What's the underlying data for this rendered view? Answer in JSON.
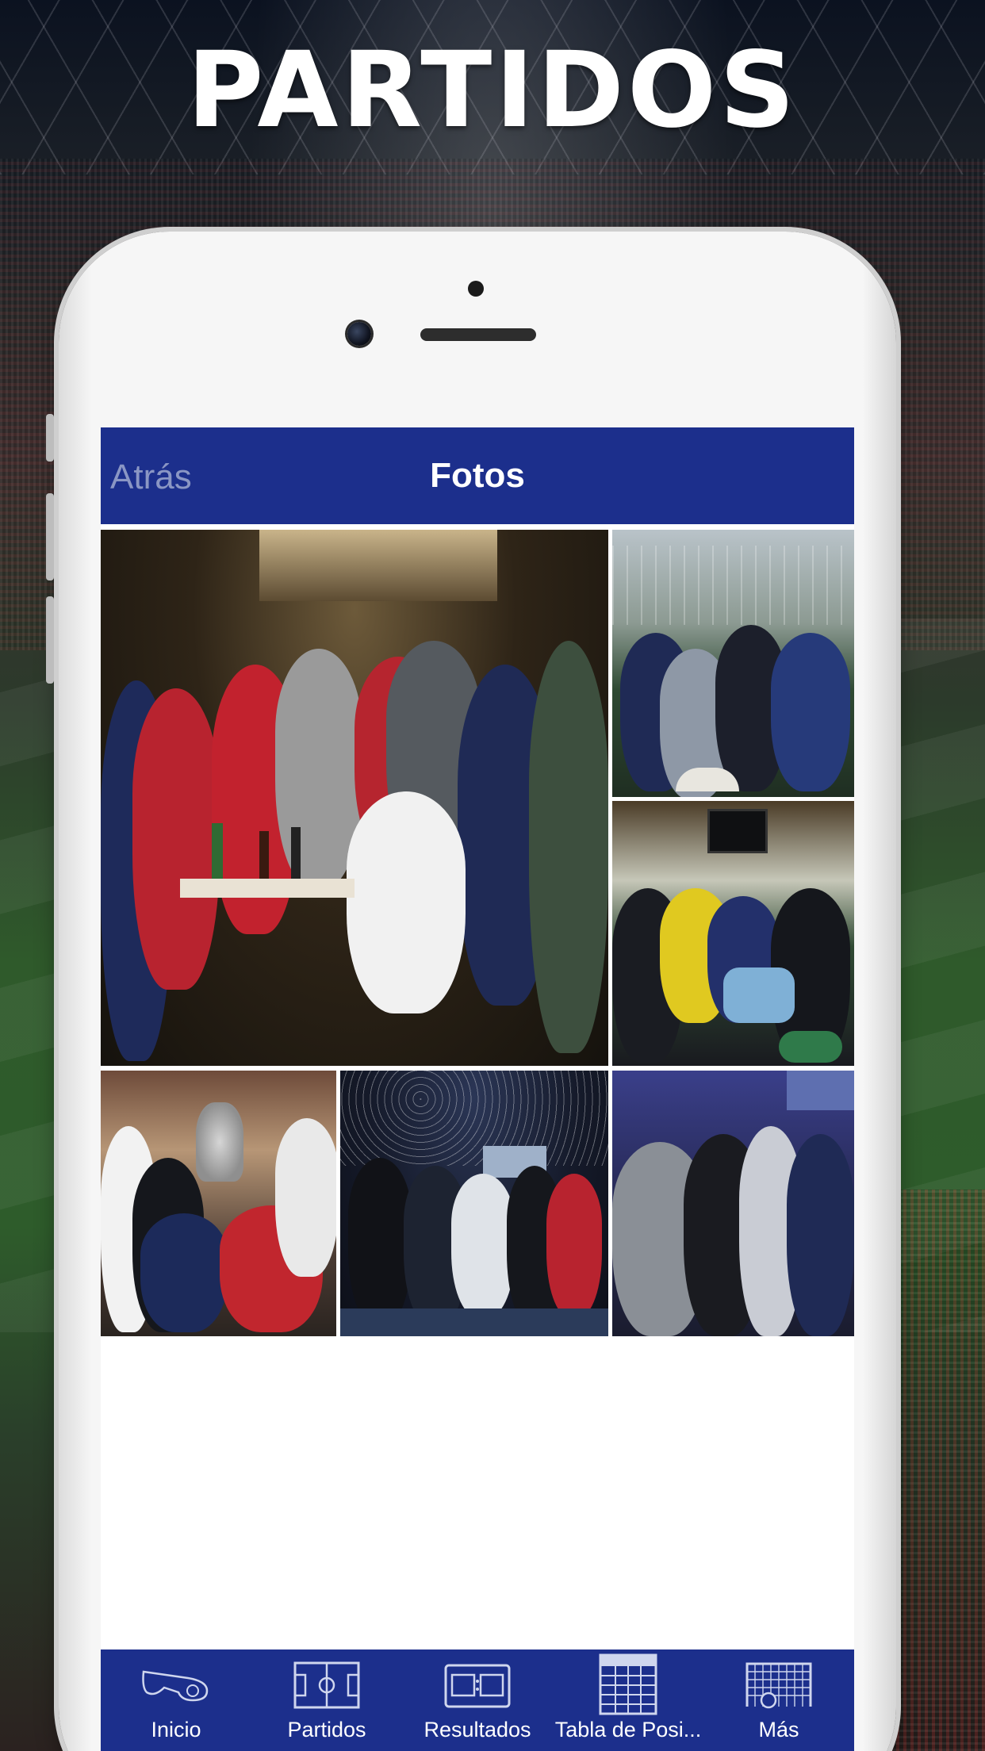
{
  "promo": {
    "headline": "PARTIDOS"
  },
  "navbar": {
    "back_label": "Atrás",
    "title": "Fotos"
  },
  "gallery": {
    "photos": [
      {
        "name": "photo-1"
      },
      {
        "name": "photo-2"
      },
      {
        "name": "photo-3"
      },
      {
        "name": "photo-4"
      },
      {
        "name": "photo-5"
      },
      {
        "name": "photo-6"
      }
    ]
  },
  "tabbar": {
    "items": [
      {
        "label": "Inicio",
        "icon": "whistle-icon"
      },
      {
        "label": "Partidos",
        "icon": "soccer-field-icon"
      },
      {
        "label": "Resultados",
        "icon": "scoreboard-icon"
      },
      {
        "label": "Tabla de Posi...",
        "icon": "standings-table-icon"
      },
      {
        "label": "Más",
        "icon": "goal-net-icon"
      }
    ]
  },
  "colors": {
    "brand_blue": "#1c2f8c",
    "back_text": "#8a96c4",
    "screen_bg": "#ffffff"
  }
}
